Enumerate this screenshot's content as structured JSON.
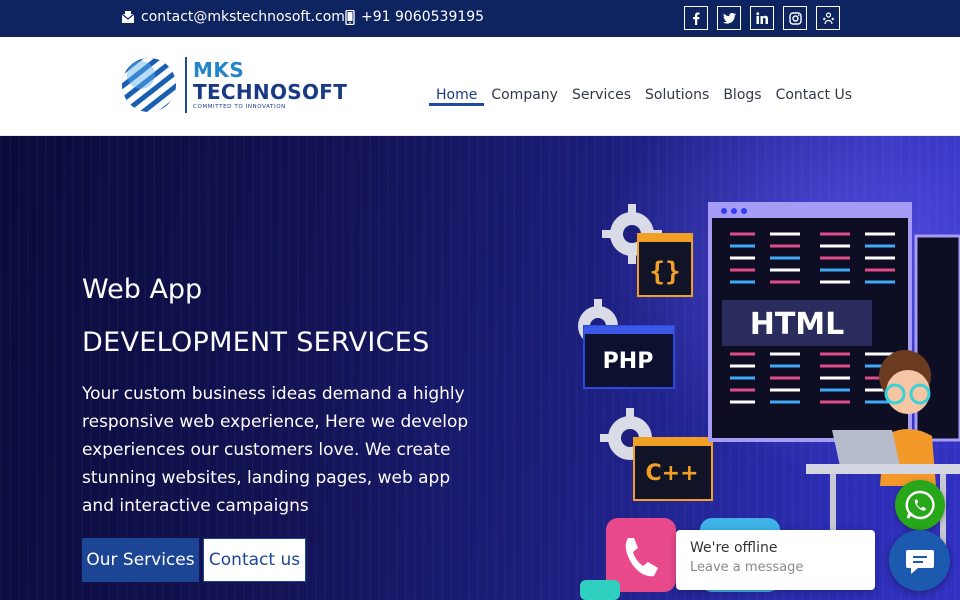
{
  "topbar": {
    "email": "contact@mkstechnosoft.com",
    "phone": "+91 9060539195",
    "socials": [
      "facebook-icon",
      "twitter-icon",
      "linkedin-icon",
      "instagram-icon",
      "people-icon"
    ]
  },
  "header": {
    "logo_mks": "MKS",
    "logo_technosoft": "TECHNOSOFT",
    "logo_tagline": "COMMITTED TO INNOVATION",
    "nav": [
      {
        "label": "Home",
        "active": true
      },
      {
        "label": "Company"
      },
      {
        "label": "Services"
      },
      {
        "label": "Solutions"
      },
      {
        "label": "Blogs"
      },
      {
        "label": "Contact Us"
      }
    ]
  },
  "hero": {
    "title_line1": "Web App",
    "title_line2": "DEVELOPMENT SERVICES",
    "description": "Your custom business ideas demand a highly responsive web experience, Here we develop experiences our customers love. We create stunning websites, landing pages, web app and interactive campaigns",
    "primary_button": "Our Services",
    "secondary_button": "Contact us",
    "illustration_labels": {
      "html": "HTML",
      "php": "PHP",
      "cpp": "C++",
      "braces": "{}"
    }
  },
  "chat": {
    "status": "We're offline",
    "subtitle": "Leave a message"
  },
  "colors": {
    "topbar_bg": "#0d2461",
    "brand_blue": "#1c4596",
    "whatsapp_green": "#29a71a",
    "chat_blue": "#1c5ab0"
  }
}
